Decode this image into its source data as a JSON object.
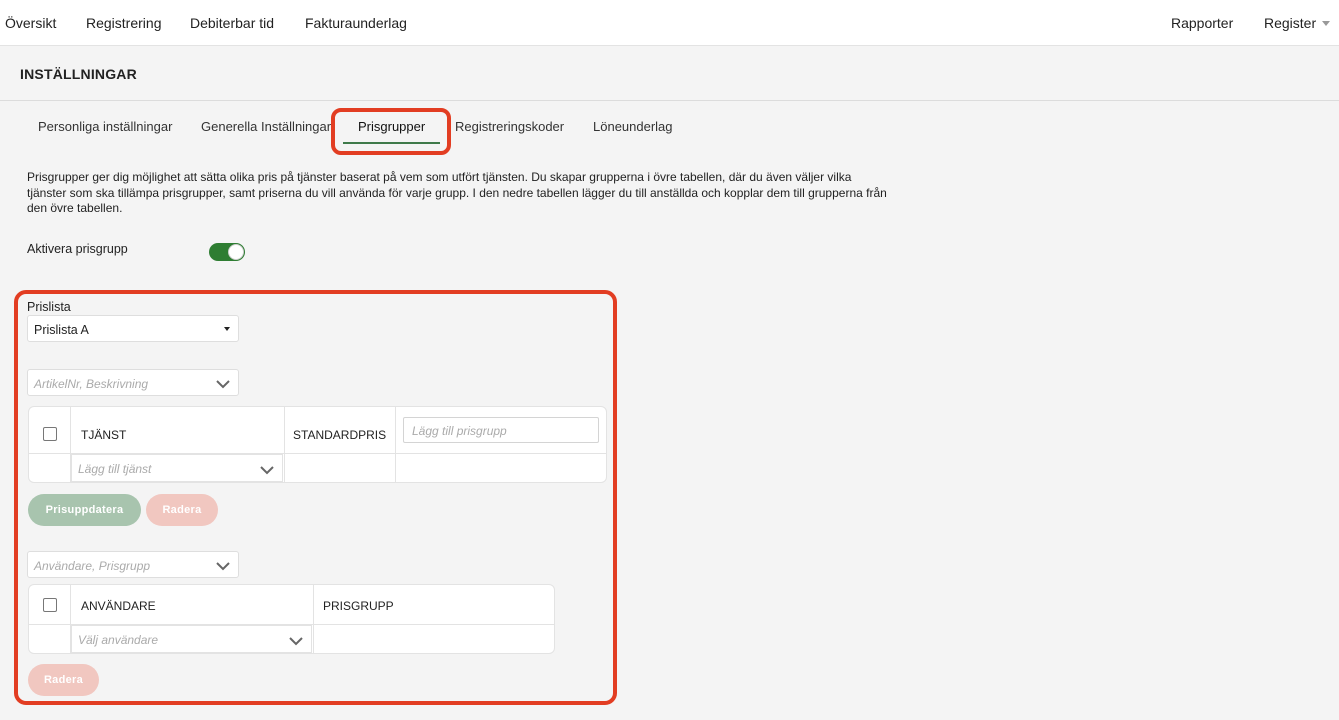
{
  "topnav": {
    "left": [
      "Översikt",
      "Registrering",
      "Debiterbar tid",
      "Fakturaunderlag"
    ],
    "rapporter": "Rapporter",
    "register": "Register"
  },
  "page_title": "INSTÄLLNINGAR",
  "tabs": [
    "Personliga inställningar",
    "Generella Inställningar",
    "Prisgrupper",
    "Registreringskoder",
    "Löneunderlag"
  ],
  "active_tab": "Prisgrupper",
  "description": "Prisgrupper ger dig möjlighet att sätta olika pris på tjänster baserat på vem som utfört tjänsten. Du skapar grupperna i övre tabellen, där du även väljer vilka tjänster som ska tillämpa prisgrupper, samt priserna du vill använda för varje grupp. I den nedre tabellen lägger du till anställda och kopplar dem till grupperna från den övre tabellen.",
  "toggle": {
    "label": "Aktivera prisgrupp",
    "on": true
  },
  "prislista": {
    "label": "Prislista",
    "selected": "Prislista A"
  },
  "article_filter": {
    "placeholder": "ArtikelNr, Beskrivning"
  },
  "services_table": {
    "headers": {
      "service": "TJÄNST",
      "standard_price": "STANDARDPRIS"
    },
    "add_group_placeholder": "Lägg till prisgrupp",
    "add_service_placeholder": "Lägg till tjänst"
  },
  "buttons": {
    "price_update": "Prisuppdatera",
    "delete": "Radera",
    "delete2": "Radera"
  },
  "user_filter": {
    "placeholder": "Användare, Prisgrupp"
  },
  "users_table": {
    "headers": {
      "user": "ANVÄNDARE",
      "price_group": "PRISGRUPP"
    },
    "select_user_placeholder": "Välj användare"
  },
  "colors": {
    "accent_green": "#2e7d32",
    "highlight_red": "#e23d22"
  }
}
